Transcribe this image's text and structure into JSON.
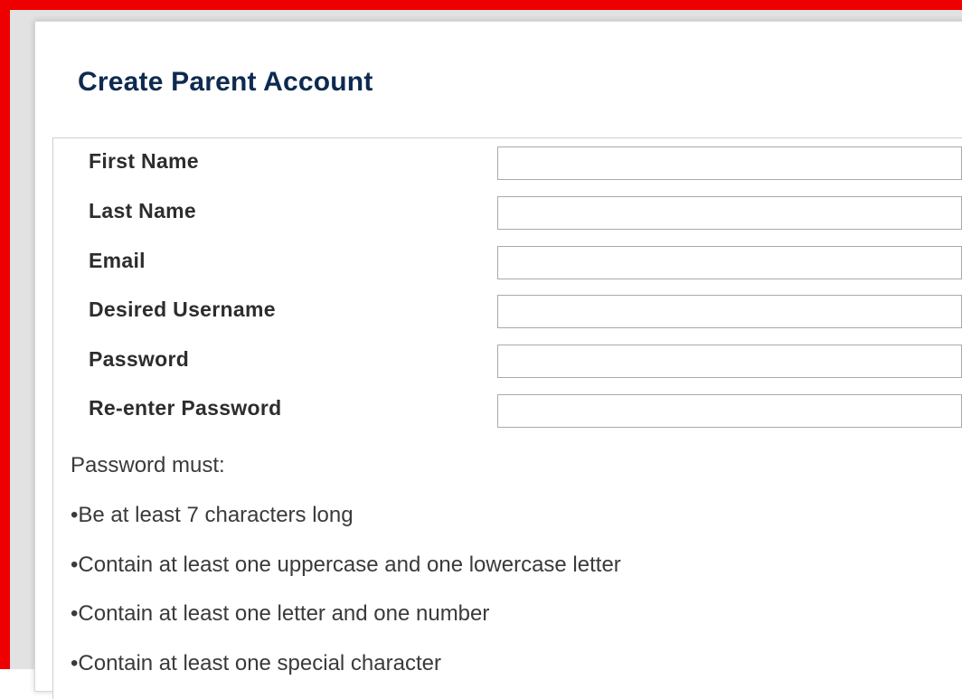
{
  "form": {
    "title": "Create Parent Account",
    "fields": [
      {
        "label": "First Name",
        "value": "",
        "placeholder": ""
      },
      {
        "label": "Last Name",
        "value": "",
        "placeholder": ""
      },
      {
        "label": "Email",
        "value": "",
        "placeholder": ""
      },
      {
        "label": "Desired Username",
        "value": "",
        "placeholder": ""
      },
      {
        "label": "Password",
        "value": "",
        "placeholder": ""
      },
      {
        "label": "Re-enter Password",
        "value": "",
        "placeholder": ""
      }
    ]
  },
  "password_rules": {
    "heading": "Password must:",
    "items": [
      "•Be at least 7 characters long",
      "•Contain at least one uppercase and one lowercase letter",
      "•Contain at least one letter and one number",
      "•Contain at least one special character"
    ]
  },
  "colors": {
    "frame_border": "#ee0000",
    "title": "#0d2a50",
    "label": "#2d2d2d"
  }
}
